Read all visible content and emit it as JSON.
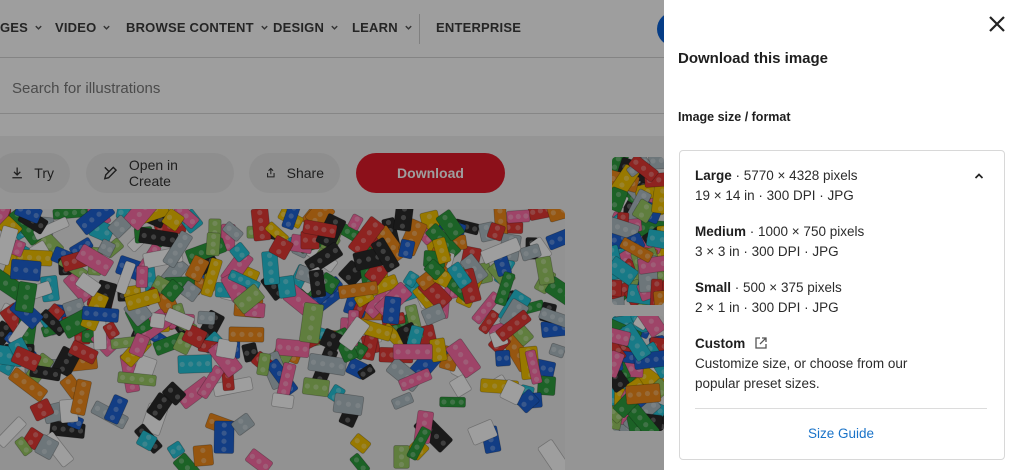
{
  "nav": {
    "items": [
      {
        "label": "GES",
        "chevron": true
      },
      {
        "label": "VIDEO",
        "chevron": true
      },
      {
        "label": "BROWSE CONTENT",
        "chevron": true
      },
      {
        "label": "DESIGN",
        "chevron": true
      },
      {
        "label": "LEARN",
        "chevron": true
      },
      {
        "label": "ENTERPRISE",
        "chevron": false
      }
    ]
  },
  "search": {
    "placeholder": "Search for illustrations"
  },
  "actions": {
    "try_label": "Try",
    "open_in_create_label": "Open in Create",
    "share_label": "Share",
    "download_label": "Download"
  },
  "panel": {
    "title": "Download this image",
    "format_label": "Image size / format",
    "options": [
      {
        "name": "Large",
        "pixels": " · 5770 × 4328 pixels",
        "detail": "19 × 14 in · 300 DPI · JPG"
      },
      {
        "name": "Medium",
        "pixels": " · 1000 × 750 pixels",
        "detail": "3 × 3 in · 300 DPI · JPG"
      },
      {
        "name": "Small",
        "pixels": " · 500 × 375 pixels",
        "detail": "2 × 1 in · 300 DPI · JPG"
      }
    ],
    "custom": {
      "name": "Custom",
      "line1": "Customize size, or choose from our",
      "line2": "popular preset sizes."
    },
    "size_guide_label": "Size Guide"
  },
  "colors": {
    "download_button": "#e31b2b",
    "link": "#1a73c8",
    "avatar": "#0b63d8"
  },
  "icons": [
    "chevron-down-icon",
    "download-icon",
    "edit-icon",
    "share-icon",
    "close-icon",
    "chevron-up-icon",
    "external-link-icon"
  ]
}
